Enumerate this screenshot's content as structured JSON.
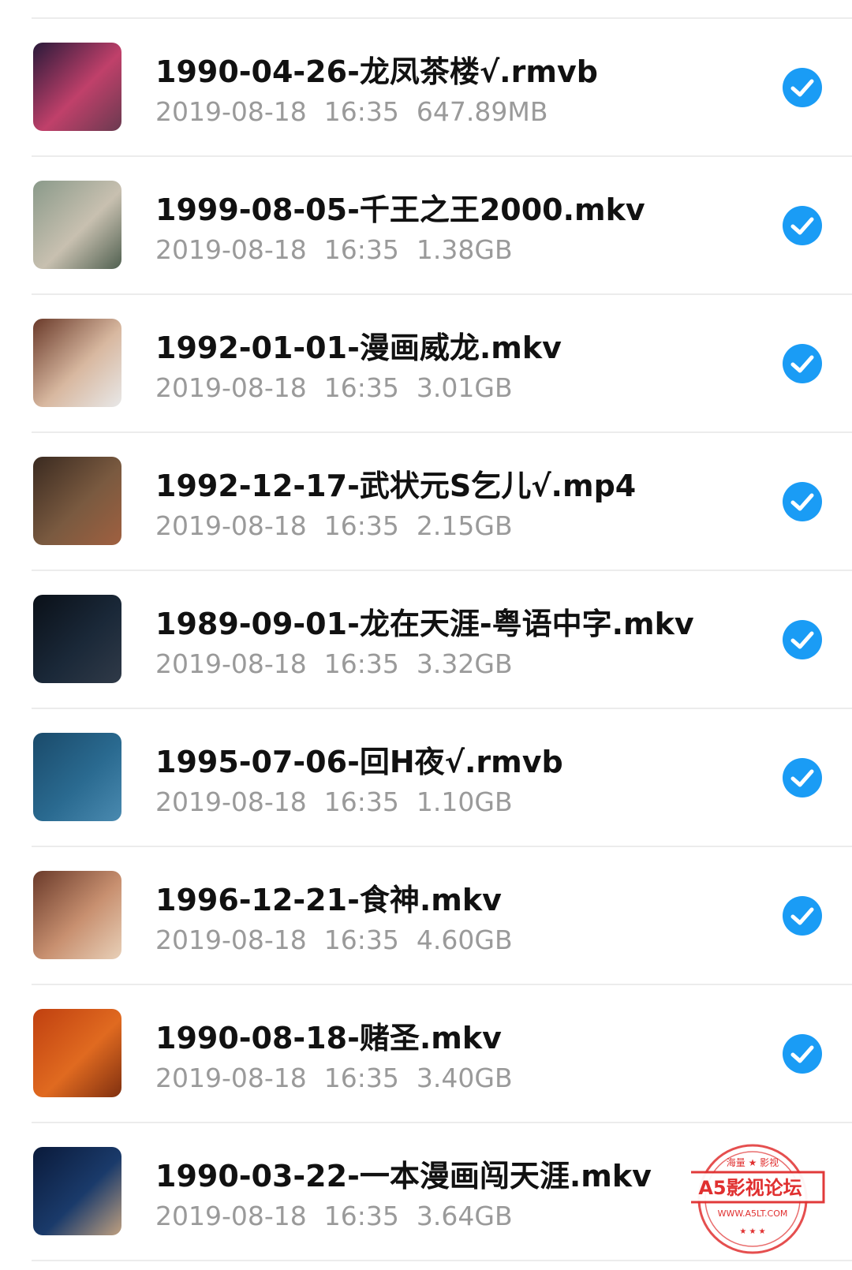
{
  "files": [
    {
      "name": "1990-04-26-龙凤茶楼√.rmvb",
      "date": "2019-08-18",
      "time": "16:35",
      "size": "647.89MB",
      "selected": true,
      "thumb_colors": [
        "#2a1a3a",
        "#c0406a",
        "#6a3a50"
      ]
    },
    {
      "name": "1999-08-05-千王之王2000.mkv",
      "date": "2019-08-18",
      "time": "16:35",
      "size": "1.38GB",
      "selected": true,
      "thumb_colors": [
        "#8a9a8a",
        "#c8c0b0",
        "#506050"
      ]
    },
    {
      "name": "1992-01-01-漫画威龙.mkv",
      "date": "2019-08-18",
      "time": "16:35",
      "size": "3.01GB",
      "selected": true,
      "thumb_colors": [
        "#6a3a2a",
        "#d8b8a0",
        "#e8e8e8"
      ]
    },
    {
      "name": "1992-12-17-武状元S乞儿√.mp4",
      "date": "2019-08-18",
      "time": "16:35",
      "size": "2.15GB",
      "selected": true,
      "thumb_colors": [
        "#3a2a20",
        "#7a5a40",
        "#a06040"
      ]
    },
    {
      "name": "1989-09-01-龙在天涯-粤语中字.mkv",
      "date": "2019-08-18",
      "time": "16:35",
      "size": "3.32GB",
      "selected": true,
      "thumb_colors": [
        "#0a1018",
        "#1a2838",
        "#303a48"
      ]
    },
    {
      "name": "1995-07-06-回H夜√.rmvb",
      "date": "2019-08-18",
      "time": "16:35",
      "size": "1.10GB",
      "selected": true,
      "thumb_colors": [
        "#1a4a6a",
        "#2a6a90",
        "#4a8ab0"
      ]
    },
    {
      "name": "1996-12-21-食神.mkv",
      "date": "2019-08-18",
      "time": "16:35",
      "size": "4.60GB",
      "selected": true,
      "thumb_colors": [
        "#6a3a2a",
        "#c89070",
        "#e8d0b8"
      ]
    },
    {
      "name": "1990-08-18-赌圣.mkv",
      "date": "2019-08-18",
      "time": "16:35",
      "size": "3.40GB",
      "selected": true,
      "thumb_colors": [
        "#c04010",
        "#e06a20",
        "#803010"
      ]
    },
    {
      "name": "1990-03-22-一本漫画闯天涯.mkv",
      "date": "2019-08-18",
      "time": "16:35",
      "size": "3.64GB",
      "selected": false,
      "thumb_colors": [
        "#0a1a3a",
        "#1a3a6a",
        "#c0a080"
      ]
    }
  ],
  "watermark": {
    "top_text": "海量 ★ 影视",
    "main_text": "A5影视论坛",
    "url_text": "WWW.A5LT.COM",
    "color": "#e03030"
  },
  "accent_color": "#1a9cf5"
}
